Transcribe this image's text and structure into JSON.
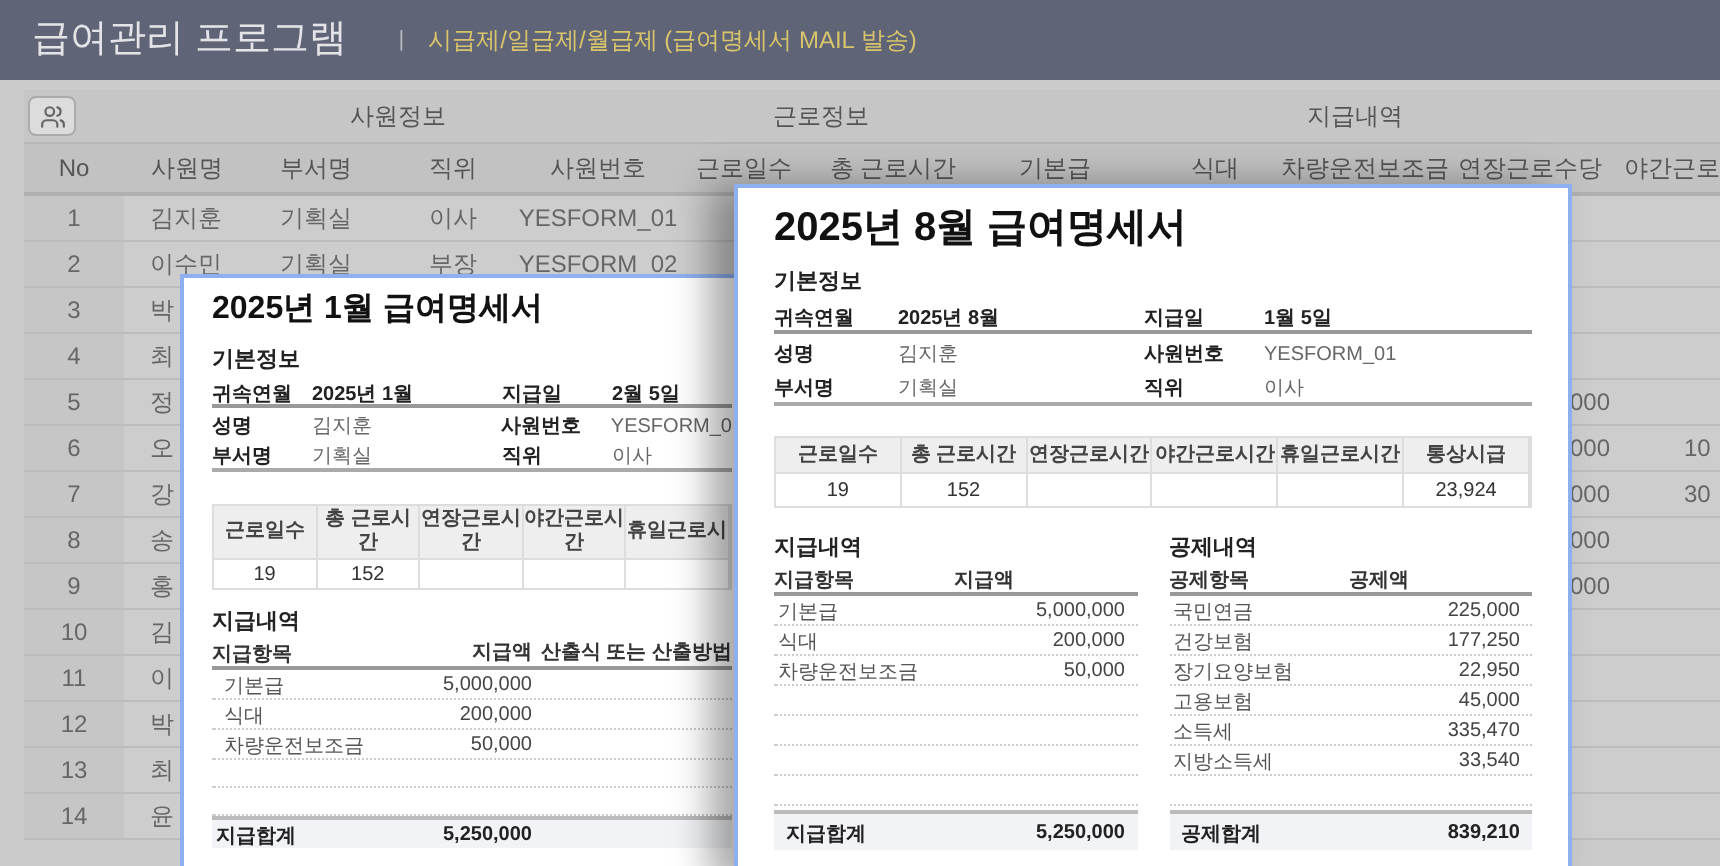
{
  "app": {
    "title": "급여관리 프로그램",
    "separator": "|",
    "subtitle": "시급제/일급제/월급제 (급여명세서 MAIL 발송)"
  },
  "table": {
    "groups": [
      "사원정보",
      "근로정보",
      "지급내역"
    ],
    "columns": [
      "No",
      "사원명",
      "부서명",
      "직위",
      "사원번호",
      "근로일수",
      "총 근로시간",
      "기본급",
      "식대",
      "차량운전보조금",
      "연장근로수당",
      "야간근로"
    ],
    "rows": [
      {
        "no": "1",
        "name": "김지훈",
        "department": "기획실",
        "position": "이사",
        "employee_no": "YESFORM_01"
      },
      {
        "no": "2",
        "name": "이수민",
        "department": "기획실",
        "position": "부장",
        "employee_no": "YESFORM_02"
      },
      {
        "no": "3",
        "name": "박"
      },
      {
        "no": "4",
        "name": "최"
      },
      {
        "no": "5",
        "name": "정",
        "overtime_pay": "000"
      },
      {
        "no": "6",
        "name": "오",
        "overtime_pay": "000",
        "night_work": "10"
      },
      {
        "no": "7",
        "name": "강",
        "overtime_pay": "000",
        "night_work": "30"
      },
      {
        "no": "8",
        "name": "송",
        "overtime_pay": "000"
      },
      {
        "no": "9",
        "name": "홍",
        "overtime_pay": "000"
      },
      {
        "no": "10",
        "name": "김"
      },
      {
        "no": "11",
        "name": "이"
      },
      {
        "no": "12",
        "name": "박"
      },
      {
        "no": "13",
        "name": "최"
      },
      {
        "no": "14",
        "name": "윤"
      }
    ]
  },
  "payslips": [
    {
      "title": "2025년 1월 급여명세서",
      "basic_heading": "기본정보",
      "basic_rows": [
        [
          {
            "label": "귀속연월",
            "value": "2025년 1월",
            "bold": true
          },
          {
            "label": "지급일",
            "value": "2월 5일",
            "bold": true
          }
        ],
        [
          {
            "label": "성명",
            "value": "김지훈",
            "bold": false
          },
          {
            "label": "사원번호",
            "value": "YESFORM_0",
            "bold": false
          }
        ],
        [
          {
            "label": "부서명",
            "value": "기획실",
            "bold": false
          },
          {
            "label": "직위",
            "value": "이사",
            "bold": false
          }
        ]
      ],
      "work": [
        {
          "header": "근로일수",
          "value": "19"
        },
        {
          "header": "총 근로시간",
          "value": "152"
        },
        {
          "header": "연장근로시간"
        },
        {
          "header": "야간근로시간"
        },
        {
          "header": "휴일근로시"
        }
      ],
      "payments": {
        "heading": "지급내역",
        "columns": [
          "지급항목",
          "지급액",
          "산출식 또는 산출방법"
        ],
        "items": [
          {
            "name": "기본급",
            "amount": "5,000,000"
          },
          {
            "name": "식대",
            "amount": "200,000"
          },
          {
            "name": "차량운전보조금",
            "amount": "50,000"
          }
        ],
        "total": {
          "label": "지급합계",
          "amount": "5,250,000"
        }
      }
    },
    {
      "title": "2025년 8월 급여명세서",
      "basic_heading": "기본정보",
      "basic_rows": [
        [
          {
            "label": "귀속연월",
            "value": "2025년 8월",
            "bold": true
          },
          {
            "label": "지급일",
            "value": "1월 5일",
            "bold": true
          }
        ],
        [
          {
            "label": "성명",
            "value": "김지훈",
            "bold": false
          },
          {
            "label": "사원번호",
            "value": "YESFORM_01",
            "bold": false
          }
        ],
        [
          {
            "label": "부서명",
            "value": "기획실",
            "bold": false
          },
          {
            "label": "직위",
            "value": "이사",
            "bold": false
          }
        ]
      ],
      "work": [
        {
          "header": "근로일수",
          "value": "19"
        },
        {
          "header": "총 근로시간",
          "value": "152"
        },
        {
          "header": "연장근로시간"
        },
        {
          "header": "야간근로시간"
        },
        {
          "header": "휴일근로시간"
        },
        {
          "header": "통상시급",
          "value": "23,924"
        }
      ],
      "payments": {
        "heading": "지급내역",
        "columns": [
          "지급항목",
          "지급액"
        ],
        "items": [
          {
            "name": "기본급",
            "amount": "5,000,000"
          },
          {
            "name": "식대",
            "amount": "200,000"
          },
          {
            "name": "차량운전보조금",
            "amount": "50,000"
          }
        ],
        "total": {
          "label": "지급합계",
          "amount": "5,250,000"
        }
      },
      "deductions": {
        "heading": "공제내역",
        "columns": [
          "공제항목",
          "공제액"
        ],
        "items": [
          {
            "name": "국민연금",
            "amount": "225,000"
          },
          {
            "name": "건강보험",
            "amount": "177,250"
          },
          {
            "name": "장기요양보험",
            "amount": "22,950"
          },
          {
            "name": "고용보험",
            "amount": "45,000"
          },
          {
            "name": "소득세",
            "amount": "335,470"
          },
          {
            "name": "지방소득세",
            "amount": "33,540"
          }
        ],
        "total": {
          "label": "공제합계",
          "amount": "839,210"
        }
      }
    }
  ]
}
